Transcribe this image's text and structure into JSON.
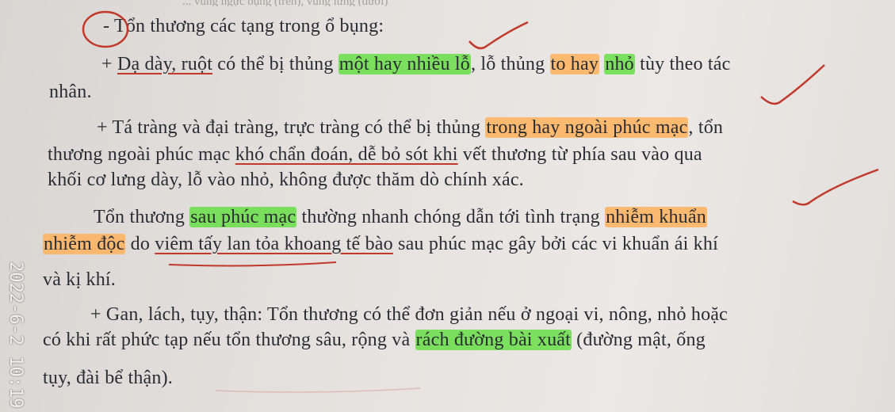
{
  "top_bleed": "... vùng ngực bụng (trên), vùng lưng (dưới)",
  "lines": {
    "l1": "- Tổn thương các tạng trong ổ bụng:",
    "l2_a": "+ ",
    "l2_b": "Dạ dày, ruột",
    "l2_c": " có thể bị thủng ",
    "l2_d": "một hay nhiều lỗ",
    "l2_e": ", lỗ thủng ",
    "l2_f": "to hay",
    "l2_g": " ",
    "l2_h": "nhỏ",
    "l2_i": " tùy theo tác",
    "l3": "nhân.",
    "l4_a": "+ Tá tràng và đại tràng, trực tràng có thể bị thủng ",
    "l4_b": "trong hay ngoài phúc mạc",
    "l4_c": ", tổn",
    "l5_a": "thương ngoài phúc mạc ",
    "l5_b": "khó chẩn đoán, dễ bỏ sót khi",
    "l5_c": " vết thương từ phía sau vào qua",
    "l6": "khối cơ lưng dày, lỗ vào nhỏ, không được thăm dò chính xác.",
    "l7_a": "Tổn thương ",
    "l7_b": "sau phúc mạc",
    "l7_c": " thường nhanh chóng dẫn tới tình trạng ",
    "l7_d": "nhiễm khuẩn",
    "l8_a": "nhiễm độc",
    "l8_b": " do ",
    "l8_c": "viêm tấy lan tỏa khoang tế bào",
    "l8_d": " sau phúc mạc gây bởi các vi khuẩn ái khí",
    "l9": "và kị khí.",
    "l10": "+ Gan, lách, tụy, thận: Tổn thương có thể đơn giản nếu ở ngoại vi, nông, nhỏ hoặc",
    "l11_a": "có khi rất phức tạp nếu tổn thương sâu, rộng và ",
    "l11_b": "rách đường bài xuất",
    "l11_c": " (đường mật, ống",
    "l12": "tụy, đài bể thận)."
  },
  "timestamp": "2022-6-2 10:19",
  "colors": {
    "green_highlight": "#67de46",
    "orange_highlight": "#ffb25c",
    "ink_red": "#c0392b"
  }
}
